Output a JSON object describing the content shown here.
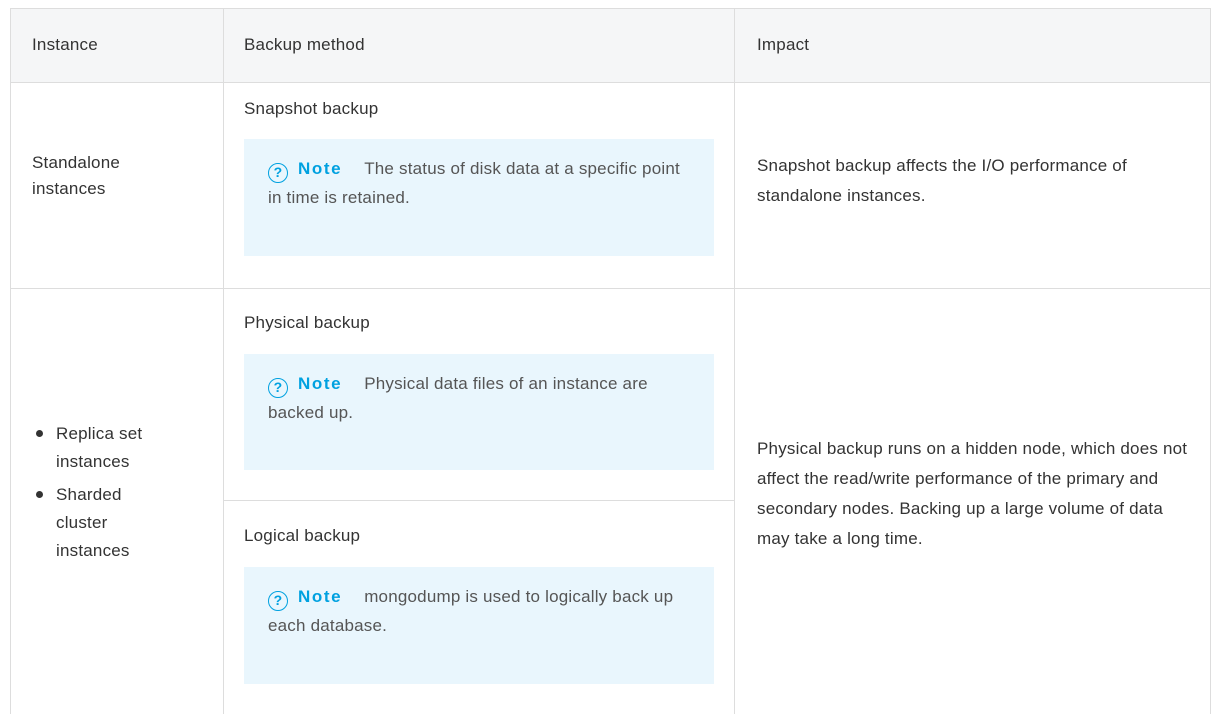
{
  "table": {
    "headers": {
      "instance": "Instance",
      "method": "Backup method",
      "impact": "Impact"
    },
    "rows": [
      {
        "instance": "Standalone instances",
        "methods": [
          {
            "name": "Snapshot backup",
            "note_label": "Note",
            "note_text": "The status of disk data at a specific point in time is retained."
          }
        ],
        "impact": "Snapshot backup affects the I/O performance of standalone instances."
      },
      {
        "instance_list": [
          "Replica set instances",
          "Sharded cluster instances"
        ],
        "methods": [
          {
            "name": "Physical backup",
            "note_label": "Note",
            "note_text": "Physical data files of an instance are backed up."
          },
          {
            "name": "Logical backup",
            "note_label": "Note",
            "note_text": "mongodump is used to logically back up each database."
          }
        ],
        "impact": "Physical backup runs on a hidden node, which does not affect the read/write performance of the primary and secondary nodes. Backing up a large volume of data may take a long time."
      }
    ]
  },
  "icons": {
    "note": "question-circle-icon"
  },
  "colors": {
    "header_bg": "#f5f6f7",
    "border": "#dddddd",
    "note_bg": "#e9f6fd",
    "note_accent": "#00a1e0"
  }
}
